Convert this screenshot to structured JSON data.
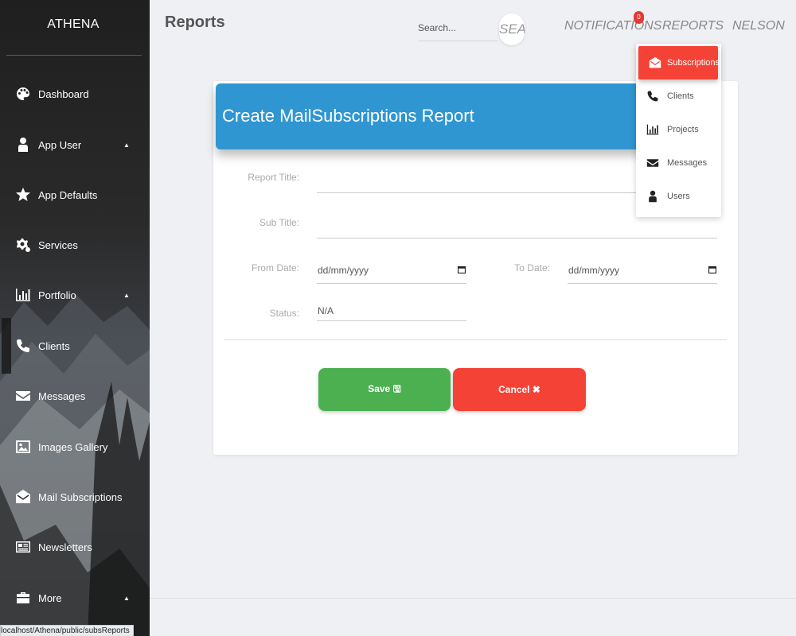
{
  "app": {
    "brand": "ATHENA",
    "page_title": "Reports"
  },
  "sidebar": {
    "items": [
      {
        "label": "Dashboard",
        "icon": "palette-icon",
        "caret": ""
      },
      {
        "label": "App User",
        "icon": "user-icon",
        "caret": "▲"
      },
      {
        "label": "App Defaults",
        "icon": "star-icon",
        "caret": ""
      },
      {
        "label": "Services",
        "icon": "gears-icon",
        "caret": ""
      },
      {
        "label": "Portfolio",
        "icon": "bar-chart-icon",
        "caret": "▲"
      },
      {
        "label": "Clients",
        "icon": "phone-icon",
        "caret": ""
      },
      {
        "label": "Messages",
        "icon": "envelope-icon",
        "caret": ""
      },
      {
        "label": "Images Gallery",
        "icon": "image-icon",
        "caret": ""
      },
      {
        "label": "Mail Subscriptions",
        "icon": "envelope-open-icon",
        "caret": ""
      },
      {
        "label": "Newsletters",
        "icon": "newspaper-icon",
        "caret": ""
      },
      {
        "label": "More",
        "icon": "briefcase-icon",
        "caret": "▲"
      }
    ]
  },
  "header": {
    "search": {
      "placeholder": "Search...",
      "button_label": "SEA"
    },
    "notifications": {
      "label": "NOTIFICATIONS",
      "count": "0"
    },
    "reports_label": "REPORTS",
    "user_label": "NELSON"
  },
  "dropdown": {
    "items": [
      {
        "label": "Subscriptions",
        "icon": "envelope-open-icon",
        "active": true
      },
      {
        "label": "Clients",
        "icon": "phone-icon",
        "active": false
      },
      {
        "label": "Projects",
        "icon": "bar-chart-icon",
        "active": false
      },
      {
        "label": "Messages",
        "icon": "envelope-icon",
        "active": false
      },
      {
        "label": "Users",
        "icon": "user-icon",
        "active": false
      }
    ]
  },
  "form": {
    "heading": "Create MailSubscriptions Report",
    "report_title_label": "Report Title:",
    "report_title_value": "",
    "sub_title_label": "Sub Title:",
    "sub_title_value": "",
    "from_date_label": "From Date:",
    "from_date_value": "dd/mm/yyyy",
    "to_date_label": "To Date:",
    "to_date_value": "dd/mm/yyyy",
    "status_label": "Status:",
    "status_value": "N/A",
    "save_label": "Save 🖫",
    "cancel_label": "Cancel ✖"
  },
  "status_bar": {
    "url": "localhost/Athena/public/subsReports"
  },
  "colors": {
    "header_blue": "#2f96d2",
    "save_green": "#4caf50",
    "cancel_red": "#f44336",
    "badge_red": "#e53935"
  }
}
